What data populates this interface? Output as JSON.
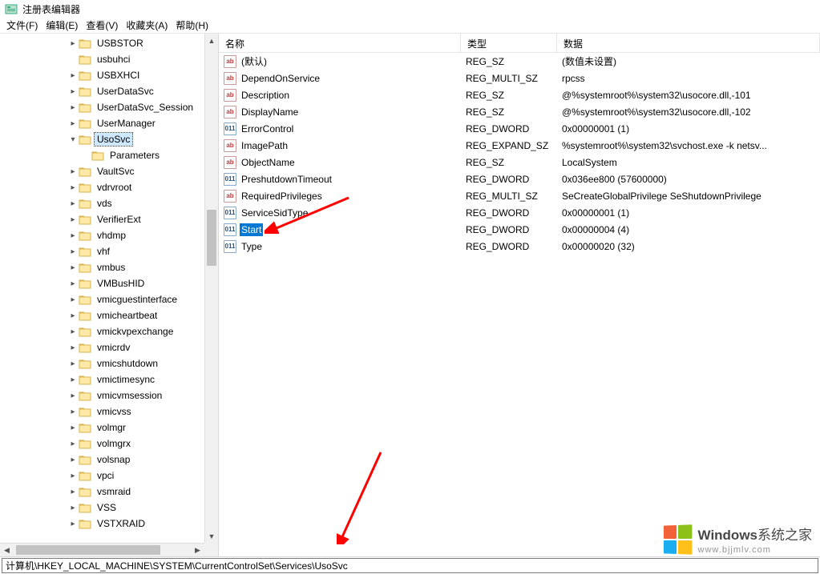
{
  "window": {
    "title": "注册表编辑器"
  },
  "menu": {
    "file": "文件(F)",
    "edit": "编辑(E)",
    "view": "查看(V)",
    "favorites": "收藏夹(A)",
    "help": "帮助(H)"
  },
  "columns": {
    "name": "名称",
    "type": "类型",
    "data": "数据"
  },
  "tree": [
    {
      "depth": 5,
      "exp": ">",
      "label": "USBSTOR"
    },
    {
      "depth": 5,
      "exp": "",
      "label": "usbuhci"
    },
    {
      "depth": 5,
      "exp": ">",
      "label": "USBXHCI"
    },
    {
      "depth": 5,
      "exp": ">",
      "label": "UserDataSvc"
    },
    {
      "depth": 5,
      "exp": ">",
      "label": "UserDataSvc_Session"
    },
    {
      "depth": 5,
      "exp": ">",
      "label": "UserManager"
    },
    {
      "depth": 5,
      "exp": "v",
      "label": "UsoSvc",
      "selected": true
    },
    {
      "depth": 6,
      "exp": "",
      "label": "Parameters"
    },
    {
      "depth": 5,
      "exp": ">",
      "label": "VaultSvc"
    },
    {
      "depth": 5,
      "exp": ">",
      "label": "vdrvroot"
    },
    {
      "depth": 5,
      "exp": ">",
      "label": "vds"
    },
    {
      "depth": 5,
      "exp": ">",
      "label": "VerifierExt"
    },
    {
      "depth": 5,
      "exp": ">",
      "label": "vhdmp"
    },
    {
      "depth": 5,
      "exp": ">",
      "label": "vhf"
    },
    {
      "depth": 5,
      "exp": ">",
      "label": "vmbus"
    },
    {
      "depth": 5,
      "exp": ">",
      "label": "VMBusHID"
    },
    {
      "depth": 5,
      "exp": ">",
      "label": "vmicguestinterface"
    },
    {
      "depth": 5,
      "exp": ">",
      "label": "vmicheartbeat"
    },
    {
      "depth": 5,
      "exp": ">",
      "label": "vmickvpexchange"
    },
    {
      "depth": 5,
      "exp": ">",
      "label": "vmicrdv"
    },
    {
      "depth": 5,
      "exp": ">",
      "label": "vmicshutdown"
    },
    {
      "depth": 5,
      "exp": ">",
      "label": "vmictimesync"
    },
    {
      "depth": 5,
      "exp": ">",
      "label": "vmicvmsession"
    },
    {
      "depth": 5,
      "exp": ">",
      "label": "vmicvss"
    },
    {
      "depth": 5,
      "exp": ">",
      "label": "volmgr"
    },
    {
      "depth": 5,
      "exp": ">",
      "label": "volmgrx"
    },
    {
      "depth": 5,
      "exp": ">",
      "label": "volsnap"
    },
    {
      "depth": 5,
      "exp": ">",
      "label": "vpci"
    },
    {
      "depth": 5,
      "exp": ">",
      "label": "vsmraid"
    },
    {
      "depth": 5,
      "exp": ">",
      "label": "VSS"
    },
    {
      "depth": 5,
      "exp": ">",
      "label": "VSTXRAID"
    }
  ],
  "values": [
    {
      "ic": "str",
      "name": "(默认)",
      "type": "REG_SZ",
      "data": "(数值未设置)"
    },
    {
      "ic": "str",
      "name": "DependOnService",
      "type": "REG_MULTI_SZ",
      "data": "rpcss"
    },
    {
      "ic": "str",
      "name": "Description",
      "type": "REG_SZ",
      "data": "@%systemroot%\\system32\\usocore.dll,-101"
    },
    {
      "ic": "str",
      "name": "DisplayName",
      "type": "REG_SZ",
      "data": "@%systemroot%\\system32\\usocore.dll,-102"
    },
    {
      "ic": "bin",
      "name": "ErrorControl",
      "type": "REG_DWORD",
      "data": "0x00000001 (1)"
    },
    {
      "ic": "str",
      "name": "ImagePath",
      "type": "REG_EXPAND_SZ",
      "data": "%systemroot%\\system32\\svchost.exe -k netsv..."
    },
    {
      "ic": "str",
      "name": "ObjectName",
      "type": "REG_SZ",
      "data": "LocalSystem"
    },
    {
      "ic": "bin",
      "name": "PreshutdownTimeout",
      "type": "REG_DWORD",
      "data": "0x036ee800 (57600000)"
    },
    {
      "ic": "str",
      "name": "RequiredPrivileges",
      "type": "REG_MULTI_SZ",
      "data": "SeCreateGlobalPrivilege SeShutdownPrivilege"
    },
    {
      "ic": "bin",
      "name": "ServiceSidType",
      "type": "REG_DWORD",
      "data": "0x00000001 (1)"
    },
    {
      "ic": "bin",
      "name": "Start",
      "type": "REG_DWORD",
      "data": "0x00000004 (4)",
      "selected": true
    },
    {
      "ic": "bin",
      "name": "Type",
      "type": "REG_DWORD",
      "data": "0x00000020 (32)"
    }
  ],
  "status": {
    "path": "计算机\\HKEY_LOCAL_MACHINE\\SYSTEM\\CurrentControlSet\\Services\\UsoSvc"
  },
  "watermark": {
    "brand": "Windows",
    "tag": "系统之家",
    "url": "www.bjjmlv.com"
  }
}
